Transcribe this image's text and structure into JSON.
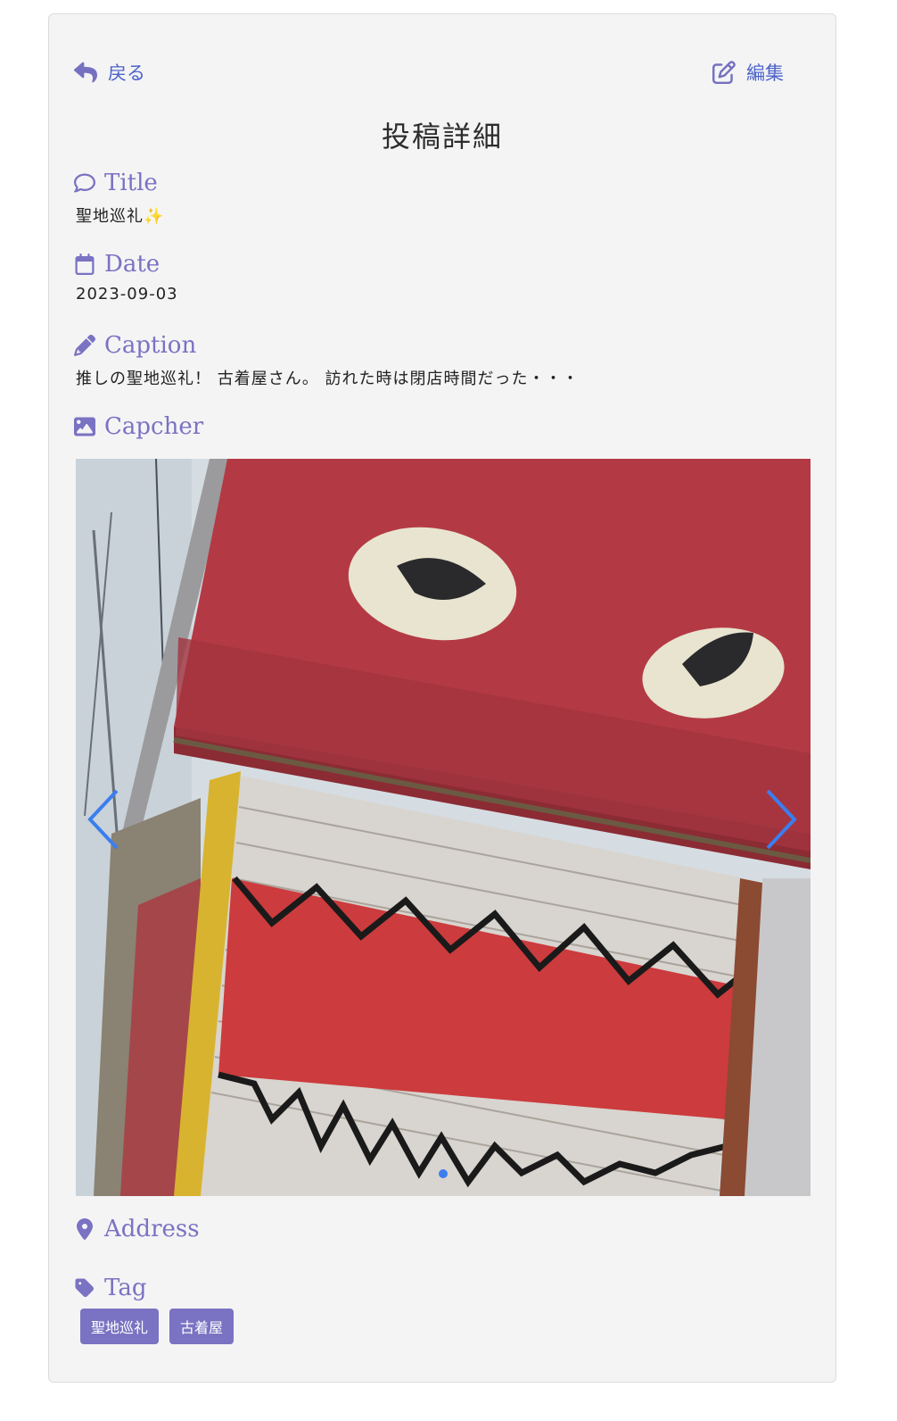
{
  "nav": {
    "back_label": "戻る",
    "edit_label": "編集"
  },
  "page_title": "投稿詳細",
  "sections": {
    "title": {
      "label": "Title",
      "value": "聖地巡礼",
      "emoji": "✨"
    },
    "date": {
      "label": "Date",
      "value": "2023-09-03"
    },
    "caption": {
      "label": "Caption",
      "value": "推しの聖地巡礼！ 古着屋さん。 訪れた時は閉店時間だった・・・"
    },
    "capcher": {
      "label": "Capcher"
    },
    "address": {
      "label": "Address",
      "value": ""
    },
    "tag": {
      "label": "Tag",
      "items": [
        "聖地巡礼",
        "古着屋"
      ]
    }
  },
  "carousel": {
    "slide_count": 1,
    "active_index": 0
  },
  "icons": {
    "back": "reply-arrow-icon",
    "edit": "edit-square-icon",
    "title": "comment-icon",
    "date": "calendar-icon",
    "caption": "pencil-icon",
    "capcher": "image-icon",
    "address": "map-pin-icon",
    "tag": "tag-icon"
  },
  "colors": {
    "accent": "#7a72c2",
    "link": "#4b62c9",
    "arrow": "#3b7ef0",
    "card_bg": "#f4f4f5"
  }
}
